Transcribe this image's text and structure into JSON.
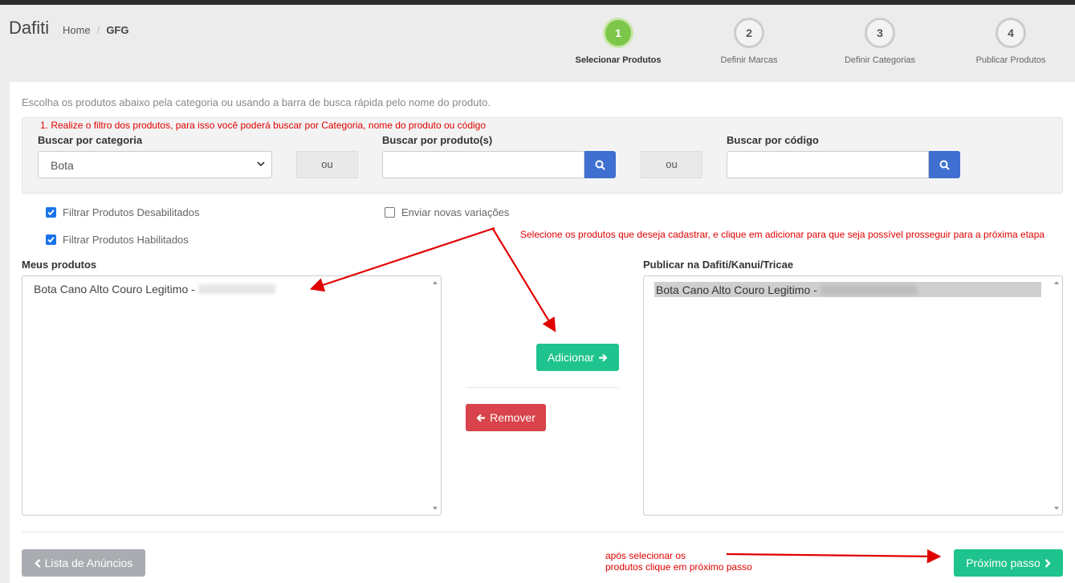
{
  "app": {
    "title": "Dafiti"
  },
  "breadcrumb": {
    "home": "Home",
    "separator": "/",
    "current": "GFG"
  },
  "steps": [
    {
      "number": "1",
      "label": "Selecionar Produtos",
      "active": true
    },
    {
      "number": "2",
      "label": "Definir Marcas",
      "active": false
    },
    {
      "number": "3",
      "label": "Definir Categorias",
      "active": false
    },
    {
      "number": "4",
      "label": "Publicar Produtos",
      "active": false
    }
  ],
  "intro": "Escolha os produtos abaixo pela categoria ou usando a barra de busca rápida pelo nome do produto.",
  "notes": {
    "filter": "1. Realize o filtro dos produtos, para isso você poderá buscar por Categoria, nome do produto ou código",
    "select": "Selecione os produtos que deseja cadastrar, e clique em adicionar para que seja possível prosseguir para a próxima etapa",
    "next_line1": "após selecionar os",
    "next_line2": "produtos clique em próximo passo"
  },
  "filters": {
    "category_label": "Buscar por categoria",
    "category_value": "Bota",
    "or1": "ou",
    "product_label": "Buscar por produto(s)",
    "product_value": "",
    "or2": "ou",
    "code_label": "Buscar por código",
    "code_value": ""
  },
  "checkboxes": {
    "disabled": {
      "label": "Filtrar Produtos Desabilitados",
      "checked": true
    },
    "enabled": {
      "label": "Filtrar Produtos Habilitados",
      "checked": true
    },
    "variations": {
      "label": "Enviar novas variações",
      "checked": false
    }
  },
  "my_products": {
    "label": "Meus produtos",
    "items": [
      "Bota Cano Alto Couro Legitimo -"
    ]
  },
  "publish": {
    "label": "Publicar na Dafiti/Kanui/Tricae",
    "items": [
      "Bota Cano Alto Couro Legitimo -"
    ]
  },
  "buttons": {
    "add": "Adicionar",
    "remove": "Remover",
    "back": "Lista de Anúncios",
    "next": "Próximo passo"
  },
  "colors": {
    "accent_green": "#1fc38e",
    "danger_red": "#d9434b",
    "primary_blue": "#3f6fd0",
    "step_active": "#7cc74a",
    "annotation_red": "#e00000"
  }
}
